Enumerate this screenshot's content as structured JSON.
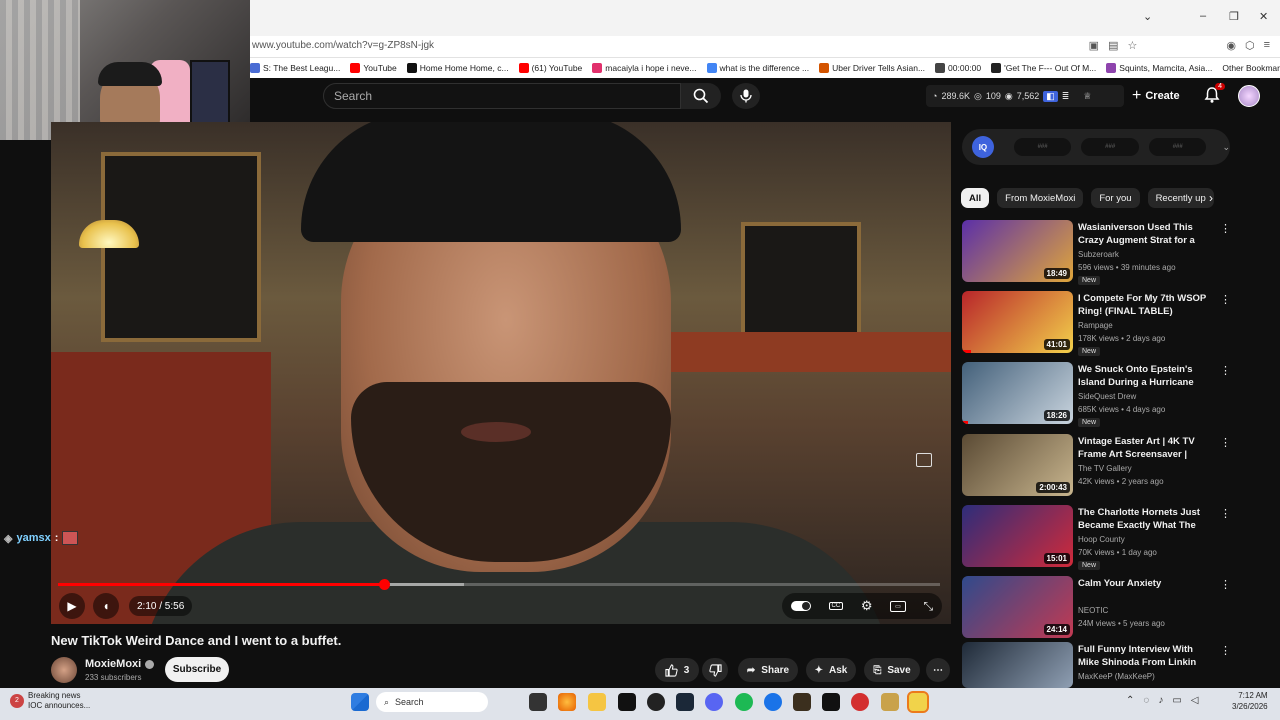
{
  "browser": {
    "url": "www.youtube.com/watch?v=g-ZP8sN-jgk",
    "bookmarks": [
      {
        "label": "S: The Best Leagu...",
        "color": "#4a6cd4"
      },
      {
        "label": "YouTube",
        "color": "#ff0000"
      },
      {
        "label": "Home Home Home, c...",
        "color": "#111111"
      },
      {
        "label": "(61) YouTube",
        "color": "#ff0000"
      },
      {
        "label": "macaiyla i hope i neve...",
        "color": "#e1306c"
      },
      {
        "label": "what is the difference ...",
        "color": "#4285f4"
      },
      {
        "label": "Uber Driver Tells Asian...",
        "color": "#d35400"
      },
      {
        "label": "00:00:00",
        "color": "#444444"
      },
      {
        "label": "'Get The F--- Out Of M...",
        "color": "#222222"
      },
      {
        "label": "Squints, Mamcita, Asia...",
        "color": "#8e44ad"
      }
    ],
    "other_bookmarks": "Other Bookmarks"
  },
  "header": {
    "search_placeholder": "Search",
    "stats": {
      "views": "289.6K",
      "likes": "109",
      "other": "7,562"
    },
    "create_label": "Create",
    "notif_count": "4"
  },
  "player": {
    "time": "2:10 / 5:56",
    "progress": 0.37,
    "buffered": 0.46,
    "chat_user": "yamsx",
    "chat_sep": ":"
  },
  "video": {
    "title": "New TikTok Weird Dance and I went to a buffet.",
    "channel": "MoxieMoxi",
    "subscribers": "233 subscribers",
    "subscribe_label": "Subscribe",
    "likes": "3",
    "share_label": "Share",
    "ask_label": "Ask",
    "save_label": "Save"
  },
  "iq": {
    "logo": "IQ",
    "pills": [
      "###",
      "###",
      "###"
    ]
  },
  "chips": [
    "All",
    "From MoxieMoxi",
    "For you",
    "Recently up"
  ],
  "recommendations": [
    {
      "title": "Wasianiverson Used This Crazy Augment Strat for a Free Win",
      "channel": "Subzeroark",
      "meta": "596 views • 39 minutes ago",
      "badge": "New",
      "duration": "18:49",
      "c1": "#5b2fa8",
      "c2": "#e0a63b",
      "watched": 0
    },
    {
      "title": "I Compete For My 7th WSOP Ring! (FINAL TABLE)",
      "channel": "Rampage",
      "meta": "178K views • 2 days ago",
      "badge": "New",
      "duration": "41:01",
      "c1": "#b8252a",
      "c2": "#f3d14b",
      "watched": 0.08
    },
    {
      "title": "We Snuck Onto Epstein's Island During a Hurricane",
      "channel": "SideQuest Drew",
      "meta": "685K views • 4 days ago",
      "badge": "New",
      "duration": "18:26",
      "c1": "#43607a",
      "c2": "#c9d4de",
      "watched": 0.05
    },
    {
      "title": "Vintage Easter Art | 4K TV Frame Art Screensaver | Vinta...",
      "channel": "The TV Gallery",
      "meta": "42K views • 2 years ago",
      "badge": "",
      "duration": "2:00:43",
      "c1": "#5a4a34",
      "c2": "#c8b58e",
      "watched": 0
    },
    {
      "title": "The Charlotte Hornets Just Became Exactly What The NB...",
      "channel": "Hoop County",
      "meta": "70K views • 1 day ago",
      "badge": "New",
      "duration": "15:01",
      "c1": "#2d2d7a",
      "c2": "#d02a3a",
      "watched": 0
    },
    {
      "title": "Calm Your Anxiety",
      "channel": "NEOTIC",
      "meta": "24M views • 5 years ago",
      "badge": "",
      "duration": "24:14",
      "c1": "#2f4a8c",
      "c2": "#c23a52",
      "watched": 0
    },
    {
      "title": "Full Funny Interview With Mike Shinoda From Linkin Park",
      "channel": "MaxKeeP (MaxKeeP)",
      "meta": "",
      "badge": "",
      "duration": "",
      "c1": "#1f2a38",
      "c2": "#8f9fb3",
      "watched": 0
    }
  ],
  "taskbar": {
    "news_title": "Breaking news",
    "news_sub": "IOC announces...",
    "news_count": "2",
    "search_label": "Search",
    "time": "7:12 AM",
    "date": "3/26/2026"
  }
}
